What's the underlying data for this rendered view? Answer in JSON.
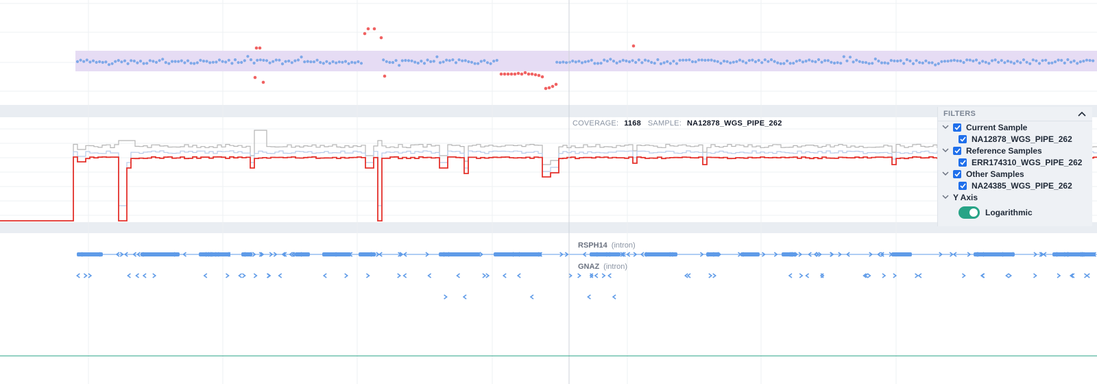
{
  "hover": {
    "coverage_label": "COVERAGE:",
    "coverage_value": "1168",
    "sample_label": "SAMPLE:",
    "sample_value": "NA12878_WGS_PIPE_262"
  },
  "genes": [
    {
      "name": "RSPH14",
      "type": "(intron)"
    },
    {
      "name": "GNAZ",
      "type": "(intron)"
    }
  ],
  "filters": {
    "title": "FILTERS",
    "groups": [
      {
        "label": "Current Sample",
        "checked": true,
        "samples": [
          {
            "label": "NA12878_WGS_PIPE_262",
            "checked": true
          }
        ]
      },
      {
        "label": "Reference Samples",
        "checked": true,
        "samples": [
          {
            "label": "ERR174310_WGS_PIPE_262",
            "checked": true
          }
        ]
      },
      {
        "label": "Other Samples",
        "checked": true,
        "samples": [
          {
            "label": "NA24385_WGS_PIPE_262",
            "checked": true
          }
        ]
      }
    ],
    "y_axis": {
      "label": "Y Axis",
      "toggle_label": "Logarithmic",
      "enabled": true
    }
  },
  "icons": {
    "collapse": "chevron-up-icon",
    "group_toggle": "chevron-down-icon",
    "checkbox": "check-icon"
  },
  "colors": {
    "current_sample": "#e5312b",
    "reference_band": "#b8cbe8",
    "other_samples": "#b5b5b5",
    "normal_point": "#7ea8e8",
    "outlier_point": "#f06262",
    "normal_range": "#e6dcf4",
    "gene_feature": "#5f9be8",
    "toggle_on": "#27a386",
    "checkbox": "#1f6feb"
  }
}
